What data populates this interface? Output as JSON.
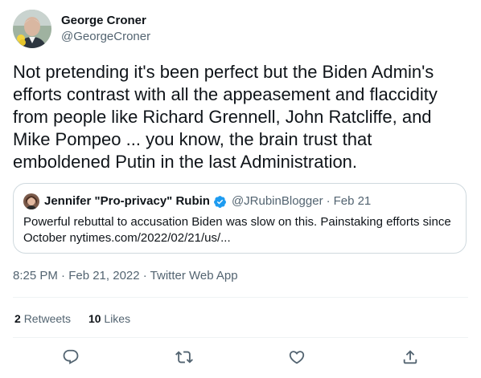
{
  "author": {
    "name": "George Croner",
    "handle": "@GeorgeCroner"
  },
  "tweet": {
    "text": "Not pretending it's been perfect but the Biden Admin's efforts contrast with all the appeasement and flaccidity from people like Richard Grennell, John Ratcliffe, and Mike Pompeo ... you know, the brain trust that emboldened Putin in the last Administration."
  },
  "quote": {
    "name": "Jennifer \"Pro-privacy\" Rubin",
    "handle": "@JRubinBlogger",
    "separator": "·",
    "date": "Feb 21",
    "text": "Powerful rebuttal to accusation Biden was slow on this. Painstaking efforts since October  nytimes.com/2022/02/21/us/..."
  },
  "meta": {
    "time": "8:25 PM · Feb 21, 2022",
    "separator": " · ",
    "app": "Twitter Web App"
  },
  "stats": {
    "retweets_count": "2",
    "retweets_label": "Retweets",
    "likes_count": "10",
    "likes_label": "Likes"
  },
  "actions": {
    "icons": [
      "reply-icon",
      "retweet-icon",
      "like-icon",
      "share-icon"
    ]
  },
  "colors": {
    "text": "#0f1419",
    "secondary": "#536471",
    "border": "#cfd9de",
    "verified": "#1d9bf0",
    "icon": "#536471"
  }
}
